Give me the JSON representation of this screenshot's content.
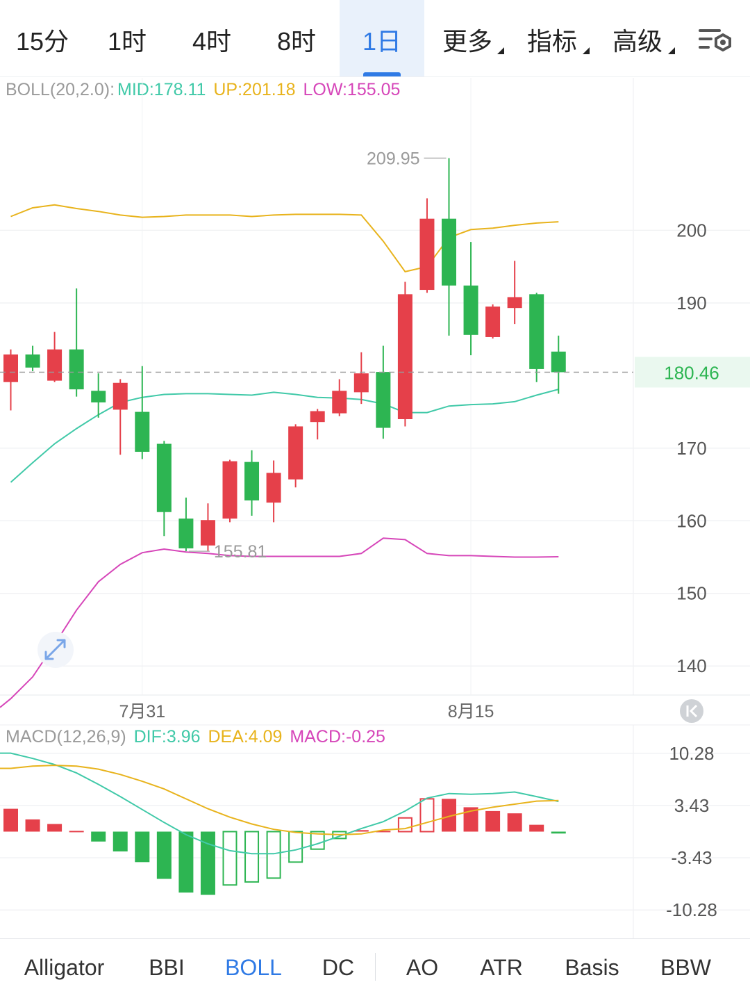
{
  "timeframes": [
    {
      "label": "15分",
      "active": false,
      "dropdown": false
    },
    {
      "label": "1时",
      "active": false,
      "dropdown": false
    },
    {
      "label": "4时",
      "active": false,
      "dropdown": false
    },
    {
      "label": "8时",
      "active": false,
      "dropdown": false
    },
    {
      "label": "1日",
      "active": true,
      "dropdown": false
    },
    {
      "label": "更多",
      "active": false,
      "dropdown": true
    },
    {
      "label": "指标",
      "active": false,
      "dropdown": true
    },
    {
      "label": "高级",
      "active": false,
      "dropdown": true
    }
  ],
  "settings_icon": "chart-settings-icon",
  "expand_icon": "expand-arrows-icon",
  "reset_icon": "scroll-to-start-icon",
  "boll_legend": {
    "name": "BOLL(20,2.0):",
    "mid": "MID:178.11",
    "up": "UP:201.18",
    "low": "LOW:155.05"
  },
  "macd_legend": {
    "name": "MACD(12,26,9)",
    "dif": "DIF:3.96",
    "dea": "DEA:4.09",
    "macd": "MACD:-0.25"
  },
  "colors": {
    "up": "#e5404a",
    "down": "#2db552",
    "mid": "#40c9a8",
    "upper": "#e8b31c",
    "lower": "#d646b9",
    "dif": "#40c9a8",
    "dea": "#e8b31c",
    "accent": "#2f7ae5"
  },
  "bottom_tabs": [
    {
      "label": "Alligator",
      "active": false
    },
    {
      "label": "BBI",
      "active": false
    },
    {
      "label": "BOLL",
      "active": true
    },
    {
      "label": "DC",
      "active": false
    },
    {
      "label": "AO",
      "active": false
    },
    {
      "label": "ATR",
      "active": false
    },
    {
      "label": "Basis",
      "active": false
    },
    {
      "label": "BBW",
      "active": false
    }
  ],
  "chart_data": [
    {
      "type": "candlestick",
      "ylim": [
        136,
        221
      ],
      "yticks": [
        "200",
        "190",
        "170",
        "160",
        "150",
        "140"
      ],
      "ytick_values": [
        200,
        190,
        170,
        160,
        150,
        140
      ],
      "xticks": [
        {
          "label": "7月31",
          "index": 6
        },
        {
          "label": "8月15",
          "index": 21
        }
      ],
      "current_price": 180.46,
      "current_price_label": "180.46",
      "high_label": "209.95",
      "low_label": "155.81",
      "high_index": 20,
      "low_index": 8,
      "candles": [
        {
          "o": 179.1,
          "c": 182.9,
          "h": 183.6,
          "l": 175.2
        },
        {
          "o": 182.9,
          "c": 181.1,
          "h": 184.1,
          "l": 180.6
        },
        {
          "o": 179.3,
          "c": 183.6,
          "h": 186.0,
          "l": 179.1
        },
        {
          "o": 183.6,
          "c": 178.1,
          "h": 192.0,
          "l": 177.1
        },
        {
          "o": 177.9,
          "c": 176.3,
          "h": 180.3,
          "l": 174.2
        },
        {
          "o": 175.3,
          "c": 179.0,
          "h": 179.5,
          "l": 169.1
        },
        {
          "o": 175.0,
          "c": 169.5,
          "h": 181.3,
          "l": 168.5
        },
        {
          "o": 170.6,
          "c": 161.2,
          "h": 171.0,
          "l": 157.9
        },
        {
          "o": 160.3,
          "c": 156.2,
          "h": 163.2,
          "l": 155.8
        },
        {
          "o": 156.6,
          "c": 160.1,
          "h": 162.4,
          "l": 155.8
        },
        {
          "o": 160.3,
          "c": 168.2,
          "h": 168.4,
          "l": 159.8
        },
        {
          "o": 168.1,
          "c": 162.8,
          "h": 169.7,
          "l": 160.7
        },
        {
          "o": 162.5,
          "c": 166.6,
          "h": 168.3,
          "l": 159.8
        },
        {
          "o": 165.7,
          "c": 173.0,
          "h": 173.3,
          "l": 164.6
        },
        {
          "o": 173.6,
          "c": 175.1,
          "h": 175.4,
          "l": 171.2
        },
        {
          "o": 174.8,
          "c": 177.9,
          "h": 179.5,
          "l": 174.4
        },
        {
          "o": 177.7,
          "c": 180.3,
          "h": 183.2,
          "l": 176.1
        },
        {
          "o": 180.5,
          "c": 172.8,
          "h": 184.1,
          "l": 171.3
        },
        {
          "o": 174.0,
          "c": 191.2,
          "h": 192.9,
          "l": 173.0
        },
        {
          "o": 191.8,
          "c": 201.6,
          "h": 204.4,
          "l": 191.4
        },
        {
          "o": 201.6,
          "c": 192.4,
          "h": 209.95,
          "l": 185.5
        },
        {
          "o": 192.4,
          "c": 185.6,
          "h": 198.4,
          "l": 182.8
        },
        {
          "o": 185.3,
          "c": 189.5,
          "h": 189.8,
          "l": 185.1
        },
        {
          "o": 189.3,
          "c": 190.8,
          "h": 195.8,
          "l": 187.1
        },
        {
          "o": 191.2,
          "c": 180.9,
          "h": 191.4,
          "l": 179.1
        },
        {
          "o": 183.3,
          "c": 180.46,
          "h": 185.5,
          "l": 177.5
        }
      ],
      "boll_series": [
        {
          "name": "UP",
          "values": [
            201.9,
            203.1,
            203.5,
            203.0,
            202.6,
            202.1,
            201.8,
            201.9,
            202.1,
            202.1,
            202.1,
            201.9,
            202.1,
            202.2,
            202.2,
            202.2,
            202.1,
            198.5,
            194.3,
            195.0,
            199.0,
            200.1,
            200.3,
            200.7,
            201.0,
            201.18
          ]
        },
        {
          "name": "MID",
          "values": [
            165.3,
            168.0,
            170.6,
            172.7,
            174.6,
            176.3,
            177.0,
            177.4,
            177.5,
            177.5,
            177.4,
            177.3,
            177.7,
            177.4,
            177.0,
            176.9,
            176.7,
            176.1,
            174.9,
            174.9,
            175.8,
            176.0,
            176.1,
            176.4,
            177.3,
            178.11
          ]
        },
        {
          "name": "LOW",
          "values": [
            135.5,
            138.5,
            143.0,
            147.7,
            151.6,
            154.0,
            155.6,
            156.1,
            155.7,
            155.5,
            155.2,
            155.1,
            155.1,
            155.1,
            155.1,
            155.1,
            155.5,
            157.6,
            157.4,
            155.5,
            155.2,
            155.2,
            155.1,
            155.0,
            155.0,
            155.05
          ]
        }
      ]
    },
    {
      "type": "macd",
      "ylim": [
        -14,
        14
      ],
      "yticks": [
        "10.28",
        "3.43",
        "-3.43",
        "-10.28"
      ],
      "ytick_values": [
        10.28,
        3.43,
        -3.43,
        -10.28
      ],
      "histogram": [
        3.0,
        1.6,
        1.0,
        0.1,
        -1.3,
        -2.6,
        -4.0,
        -6.2,
        -8.0,
        -8.3,
        -7.0,
        -6.6,
        -6.1,
        -4.0,
        -2.3,
        -0.9,
        0.2,
        0.1,
        1.8,
        4.3,
        4.3,
        3.2,
        2.7,
        2.4,
        0.9,
        -0.25
      ],
      "series": [
        {
          "name": "DIF",
          "values": [
            10.3,
            9.6,
            8.8,
            7.7,
            6.2,
            4.6,
            2.9,
            1.2,
            -0.4,
            -1.6,
            -2.5,
            -2.9,
            -2.9,
            -2.4,
            -1.6,
            -0.6,
            0.4,
            1.3,
            2.7,
            4.4,
            5.0,
            4.9,
            5.0,
            5.2,
            4.6,
            3.96
          ]
        },
        {
          "name": "DEA",
          "values": [
            8.3,
            8.6,
            8.7,
            8.6,
            8.2,
            7.5,
            6.6,
            5.6,
            4.3,
            3.0,
            1.9,
            1.0,
            0.3,
            -0.1,
            -0.3,
            -0.4,
            -0.3,
            0.2,
            0.4,
            1.2,
            2.0,
            2.7,
            3.2,
            3.6,
            4.0,
            4.09
          ]
        }
      ]
    }
  ]
}
